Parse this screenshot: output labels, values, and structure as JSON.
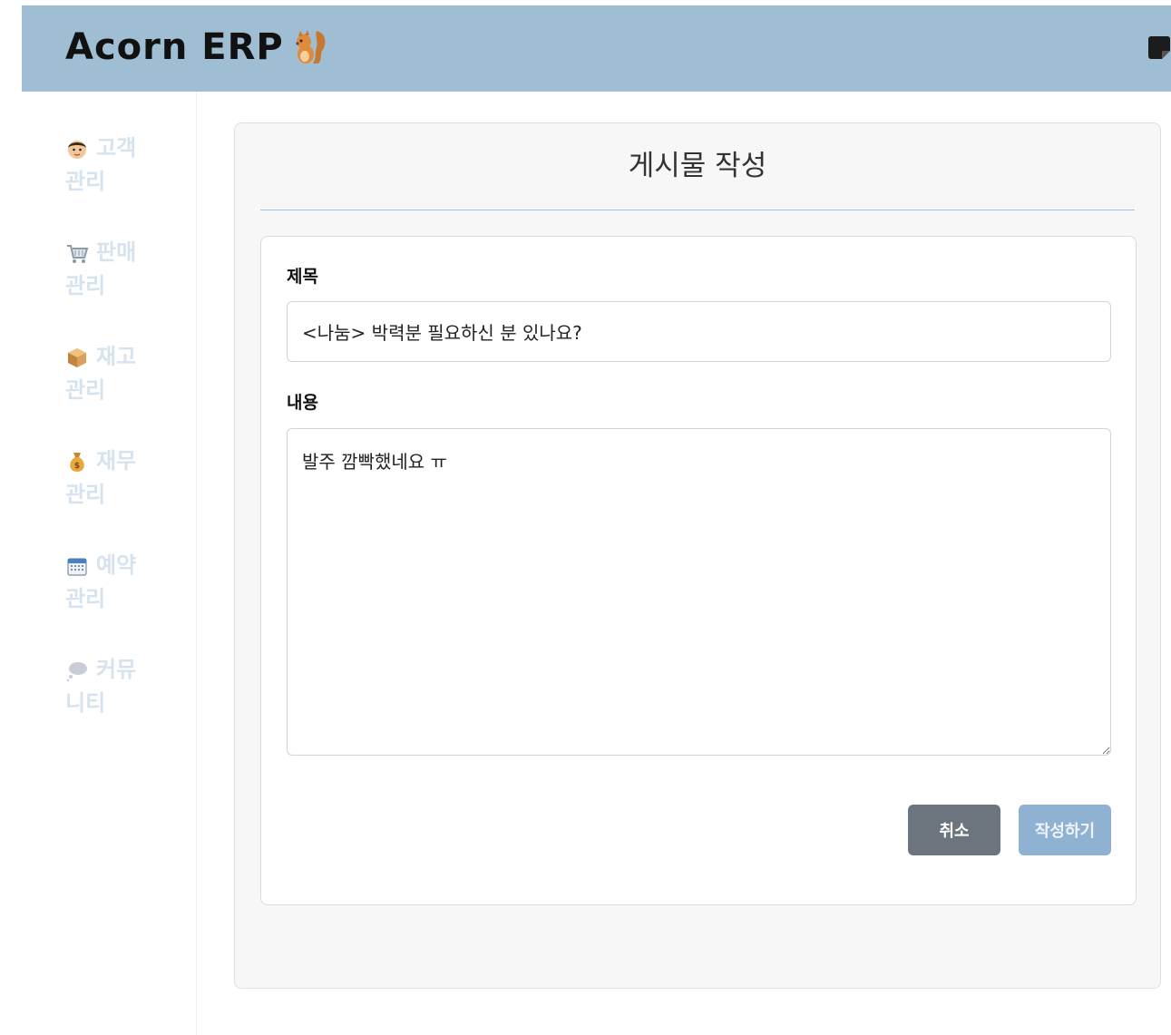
{
  "header": {
    "logo_text": "Acorn ERP",
    "logo_icon": "squirrel-icon",
    "right_icon": "sticky-note-icon",
    "bg_color": "#9fbdd3"
  },
  "sidebar": {
    "items": [
      {
        "icon": "person-icon",
        "line1": "고객",
        "line2": "관리"
      },
      {
        "icon": "cart-icon",
        "line1": "판매",
        "line2": "관리"
      },
      {
        "icon": "box-icon",
        "line1": "재고",
        "line2": "관리"
      },
      {
        "icon": "money-bag-icon",
        "line1": "재무",
        "line2": "관리"
      },
      {
        "icon": "calendar-icon",
        "line1": "예약",
        "line2": "관리"
      },
      {
        "icon": "speech-bubble-icon",
        "line1": "커뮤",
        "line2": "니티"
      }
    ],
    "text_color": "#d6e3ee"
  },
  "panel": {
    "title": "게시물 작성"
  },
  "form": {
    "title_label": "제목",
    "title_value": "<나눔> 박력분 필요하신 분 있나요?",
    "content_label": "내용",
    "content_value": "발주 깜빡했네요 ㅠ",
    "cancel_label": "취소",
    "submit_label": "작성하기"
  },
  "colors": {
    "cancel_button": "#6c757d",
    "submit_button": "#8fb2d2"
  }
}
